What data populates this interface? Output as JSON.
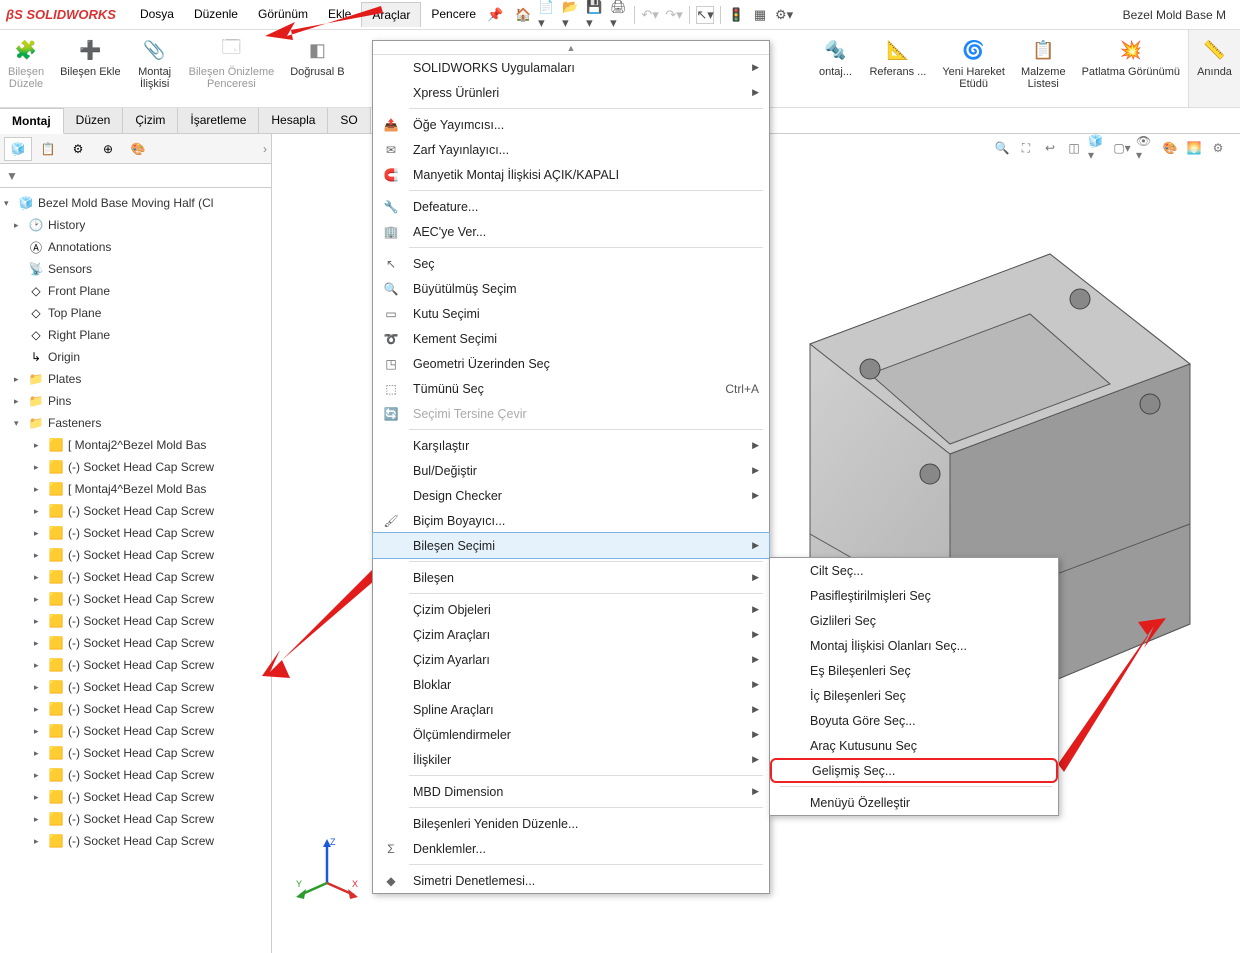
{
  "app": {
    "name": "SOLIDWORKS",
    "doc_title": "Bezel Mold Base M"
  },
  "menubar": {
    "items": [
      "Dosya",
      "Düzenle",
      "Görünüm",
      "Ekle",
      "Araçlar",
      "Pencere"
    ],
    "active_index": 4
  },
  "ribbon": {
    "buttons": [
      {
        "label": "Bileşen\nDüzele",
        "dim": true
      },
      {
        "label": "Bileşen Ekle"
      },
      {
        "label": "Montaj\nİlişkisi"
      },
      {
        "label": "Bileşen Önizleme\nPenceresi",
        "dim": true
      },
      {
        "label": "Doğrusal B"
      },
      {
        "label": "ontaj...",
        "right": true
      },
      {
        "label": "Referans ..."
      },
      {
        "label": "Yeni Hareket\nEtüdü"
      },
      {
        "label": "Malzeme\nListesi"
      },
      {
        "label": "Patlatma Görünümü"
      },
      {
        "label": "Anında",
        "last": true
      }
    ]
  },
  "command_tabs": {
    "items": [
      "Montaj",
      "Düzen",
      "Çizim",
      "İşaretleme",
      "Hesapla",
      "SO"
    ],
    "active_index": 0
  },
  "feature_tree": {
    "root": "Bezel Mold Base Moving Half  (Cl",
    "items": [
      {
        "label": "History",
        "icon": "history",
        "lvl": 1,
        "tw": "▸"
      },
      {
        "label": "Annotations",
        "icon": "annot",
        "lvl": 1
      },
      {
        "label": "Sensors",
        "icon": "sensor",
        "lvl": 1
      },
      {
        "label": "Front Plane",
        "icon": "plane",
        "lvl": 1
      },
      {
        "label": "Top Plane",
        "icon": "plane",
        "lvl": 1
      },
      {
        "label": "Right Plane",
        "icon": "plane",
        "lvl": 1
      },
      {
        "label": "Origin",
        "icon": "origin",
        "lvl": 1
      },
      {
        "label": "Plates",
        "icon": "folder",
        "lvl": 1,
        "tw": "▸"
      },
      {
        "label": "Pins",
        "icon": "folder",
        "lvl": 1,
        "tw": "▸"
      },
      {
        "label": "Fasteners",
        "icon": "folder",
        "lvl": 1,
        "tw": "▾",
        "children": [
          {
            "label": "[ Montaj2^Bezel Mold Bas"
          },
          {
            "label": "(-) Socket Head Cap Screw"
          },
          {
            "label": "[ Montaj4^Bezel Mold Bas"
          },
          {
            "label": "(-) Socket Head Cap Screw"
          },
          {
            "label": "(-) Socket Head Cap Screw"
          },
          {
            "label": "(-) Socket Head Cap Screw"
          },
          {
            "label": "(-) Socket Head Cap Screw"
          },
          {
            "label": "(-) Socket Head Cap Screw"
          },
          {
            "label": "(-) Socket Head Cap Screw"
          },
          {
            "label": "(-) Socket Head Cap Screw"
          },
          {
            "label": "(-) Socket Head Cap Screw"
          },
          {
            "label": "(-) Socket Head Cap Screw"
          },
          {
            "label": "(-) Socket Head Cap Screw"
          },
          {
            "label": "(-) Socket Head Cap Screw"
          },
          {
            "label": "(-) Socket Head Cap Screw"
          },
          {
            "label": "(-) Socket Head Cap Screw"
          },
          {
            "label": "(-) Socket Head Cap Screw"
          },
          {
            "label": "(-) Socket Head Cap Screw"
          },
          {
            "label": "(-) Socket Head Cap Screw"
          }
        ]
      }
    ]
  },
  "tools_menu": {
    "groups": [
      [
        {
          "t": "SOLIDWORKS Uygulamaları",
          "sub": true
        },
        {
          "t": "Xpress Ürünleri",
          "sub": true
        }
      ],
      [
        {
          "t": "Öğe Yayımcısı...",
          "i": "pub"
        },
        {
          "t": "Zarf Yayınlayıcı...",
          "i": "env"
        },
        {
          "t": "Manyetik Montaj İlişkisi AÇIK/KAPALI",
          "i": "mag"
        }
      ],
      [
        {
          "t": "Defeature...",
          "i": "def"
        },
        {
          "t": "AEC'ye Ver...",
          "i": "aec"
        }
      ],
      [
        {
          "t": "Seç",
          "i": "sel"
        },
        {
          "t": "Büyütülmüş Seçim",
          "i": "mag2"
        },
        {
          "t": "Kutu Seçimi",
          "i": "box"
        },
        {
          "t": "Kement Seçimi",
          "i": "lasso"
        },
        {
          "t": "Geometri Üzerinden Seç",
          "i": "geom"
        },
        {
          "t": "Tümünü Seç",
          "i": "all",
          "sc": "Ctrl+A"
        },
        {
          "t": "Seçimi Tersine Çevir",
          "i": "inv",
          "dim": true
        }
      ],
      [
        {
          "t": "Karşılaştır",
          "sub": true
        },
        {
          "t": "Bul/Değiştir",
          "sub": true
        },
        {
          "t": "Design Checker",
          "sub": true
        },
        {
          "t": "Biçim Boyayıcı...",
          "i": "paint"
        },
        {
          "t": "Bileşen Seçimi",
          "sub": true,
          "hl": true
        }
      ],
      [
        {
          "t": "Bileşen",
          "sub": true
        }
      ],
      [
        {
          "t": "Çizim Objeleri",
          "sub": true
        },
        {
          "t": "Çizim Araçları",
          "sub": true
        },
        {
          "t": "Çizim Ayarları",
          "sub": true
        },
        {
          "t": "Bloklar",
          "sub": true
        },
        {
          "t": "Spline Araçları",
          "sub": true
        },
        {
          "t": "Ölçümlendirmeler",
          "sub": true
        },
        {
          "t": "İlişkiler",
          "sub": true
        }
      ],
      [
        {
          "t": "MBD Dimension",
          "sub": true
        }
      ],
      [
        {
          "t": "Bileşenleri Yeniden Düzenle..."
        },
        {
          "t": "Denklemler...",
          "i": "sigma"
        }
      ],
      [
        {
          "t": "Simetri Denetlemesi...",
          "i": "sym"
        }
      ]
    ]
  },
  "submenu": {
    "items": [
      {
        "t": "Cilt Seç..."
      },
      {
        "t": "Pasifleştirilmişleri Seç"
      },
      {
        "t": "Gizlileri Seç"
      },
      {
        "t": "Montaj İlişkisi Olanları Seç..."
      },
      {
        "t": "Eş Bileşenleri Seç"
      },
      {
        "t": "İç Bileşenleri Seç"
      },
      {
        "t": "Boyuta Göre Seç..."
      },
      {
        "t": "Araç Kutusunu Seç"
      },
      {
        "t": "Gelişmiş Seç...",
        "red": true
      }
    ],
    "footer": "Menüyü Özelleştir"
  }
}
